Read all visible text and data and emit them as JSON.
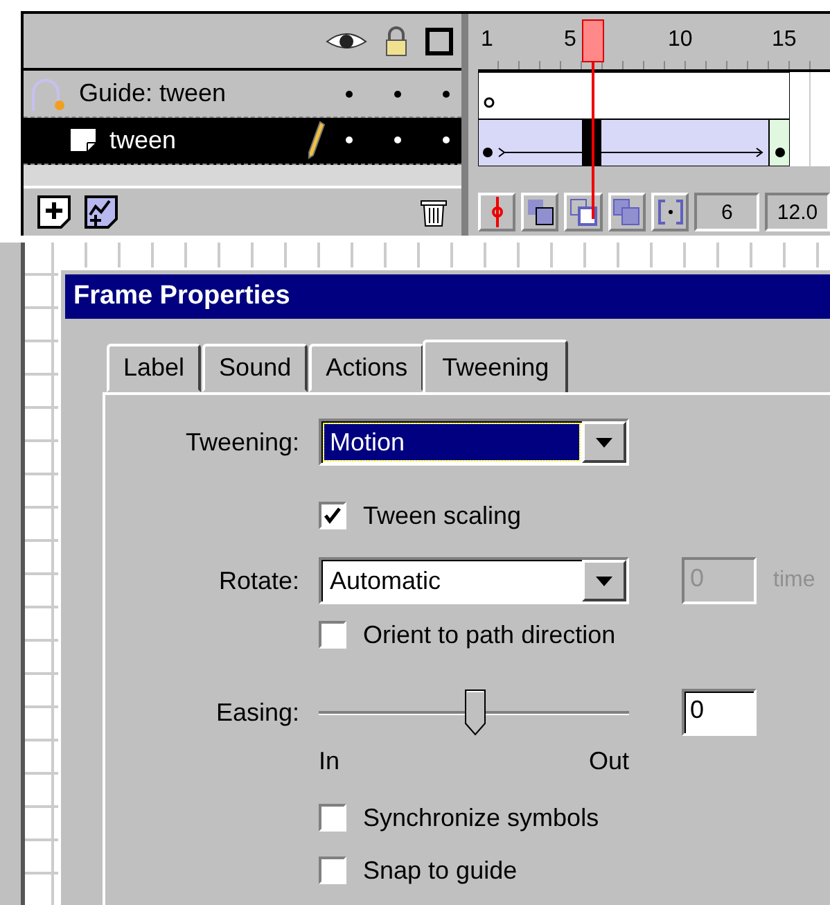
{
  "timeline": {
    "ruler": [
      "1",
      "5",
      "10",
      "15"
    ],
    "layers": [
      {
        "name": "Guide: tween",
        "kind": "guide",
        "selected": false
      },
      {
        "name": "tween",
        "kind": "tween",
        "selected": true
      }
    ],
    "current_frame": "6",
    "frame_rate": "12.0"
  },
  "dialog": {
    "title": "Frame Properties",
    "tabs": [
      {
        "label": "Label",
        "selected": false
      },
      {
        "label": "Sound",
        "selected": false
      },
      {
        "label": "Actions",
        "selected": false
      },
      {
        "label": "Tweening",
        "selected": true
      }
    ],
    "tweening": {
      "label": "Tweening:",
      "value": "Motion"
    },
    "tween_scaling": {
      "label": "Tween scaling",
      "checked": true
    },
    "rotate": {
      "label": "Rotate:",
      "value": "Automatic",
      "times_value": "0",
      "times_disabled": true,
      "times_label": "time"
    },
    "orient": {
      "label": "Orient to path direction",
      "checked": false
    },
    "easing": {
      "label": "Easing:",
      "level": 0.5,
      "value": "0",
      "min_label": "In",
      "max_label": "Out"
    },
    "synchronize": {
      "label": "Synchronize symbols",
      "checked": false
    },
    "snap": {
      "label": "Snap to guide",
      "checked": false
    }
  }
}
